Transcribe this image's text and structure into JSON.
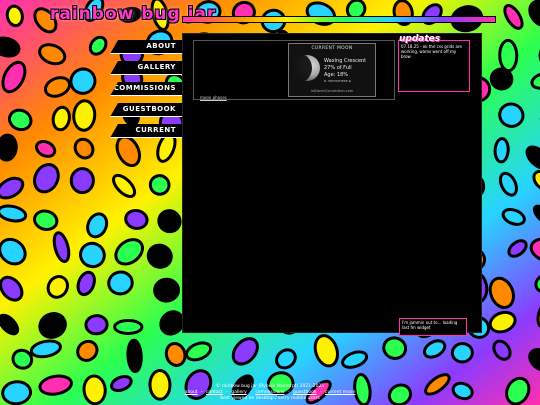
{
  "site": {
    "title": "rainbow bug jar"
  },
  "nav": {
    "items": [
      {
        "label": "ABOUT"
      },
      {
        "label": "GALLERY"
      },
      {
        "label": "COMMISSIONS"
      },
      {
        "label": "GUESTBOOK"
      },
      {
        "label": "CURRENT MOON"
      }
    ]
  },
  "main": {
    "moon_link": "moon phases",
    "moon_widget": {
      "title": "CURRENT MOON",
      "phase": "Waxing Crescent",
      "illumination": "27% of Full",
      "age": "Age: 18%",
      "hemisphere": "N. HEMISPHERE ⊞",
      "credit": "InDiscerConnection.com"
    },
    "updates": {
      "title": "updates",
      "text": "07.18.25 - ok the css grids are working, wams went off my brow"
    },
    "bottom_widget": {
      "text": "I'm jammin out to... loading last fm widget"
    }
  },
  "footer": {
    "line1": "© rainbow bug jar (Rynkie Navetrpt) 2021-2025",
    "links": [
      "about",
      "contact",
      "gallery",
      "commissions",
      "guestbook",
      "current moon"
    ],
    "separator": "-",
    "line3": "best viewed on desktop / sorry mobile users"
  },
  "colors": {
    "pink": "#ff2fb0",
    "orange": "#ff8a00",
    "yellow": "#fff200",
    "green": "#2bff4f",
    "cyan": "#27d4ff",
    "purple": "#8b3bff",
    "panel": "#000000"
  }
}
